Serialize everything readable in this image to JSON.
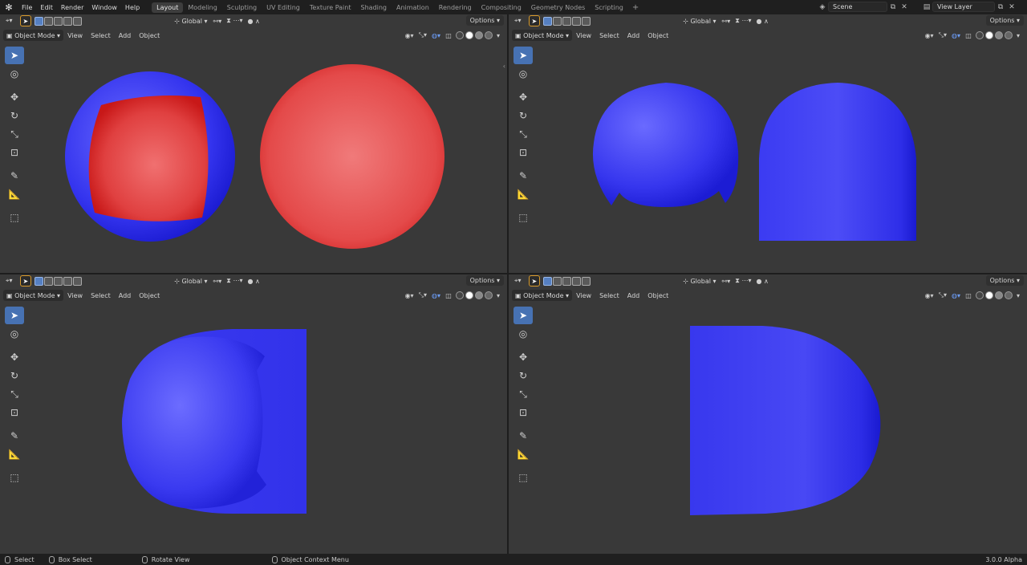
{
  "menu": [
    "File",
    "Edit",
    "Render",
    "Window",
    "Help"
  ],
  "workspace_tabs": [
    "Layout",
    "Modeling",
    "Sculpting",
    "UV Editing",
    "Texture Paint",
    "Shading",
    "Animation",
    "Rendering",
    "Compositing",
    "Geometry Nodes",
    "Scripting"
  ],
  "active_tab": "Layout",
  "scene": {
    "label": "Scene"
  },
  "view_layer": {
    "label": "View Layer"
  },
  "viewport_header": {
    "transform_orientation": "Global",
    "options": "Options",
    "mode": "Object Mode",
    "menus": [
      "View",
      "Select",
      "Add",
      "Object"
    ]
  },
  "status": {
    "select": "Select",
    "box_select": "Box Select",
    "rotate_view": "Rotate View",
    "context_menu": "Object Context Menu",
    "version": "3.0.0 Alpha"
  },
  "colors": {
    "blue_mesh": "#3a3af0",
    "red_mesh": "#e24848",
    "viewport_bg": "#393939",
    "accent": "#4772b3"
  }
}
